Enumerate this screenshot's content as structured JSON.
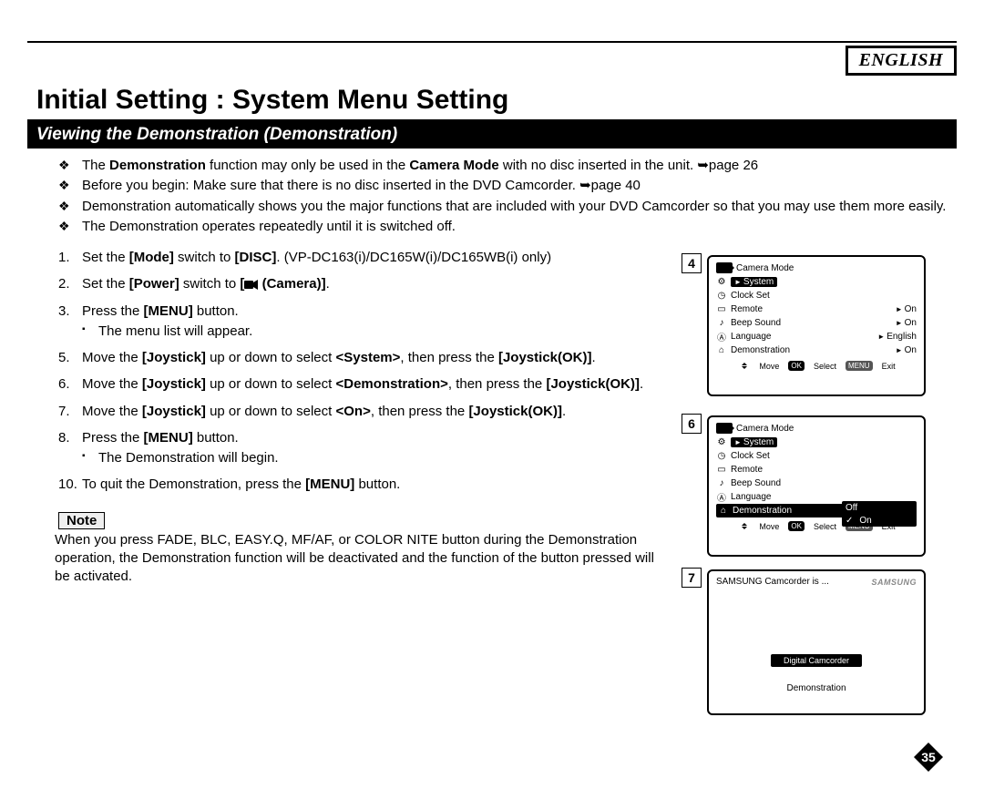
{
  "language_badge": "ENGLISH",
  "title": "Initial Setting : System Menu Setting",
  "subheading": "Viewing the Demonstration (Demonstration)",
  "page_number": "35",
  "bullets": [
    {
      "pre": "The ",
      "b1": "Demonstration",
      "mid": " function may only be used in the ",
      "b2": "Camera Mode",
      "post": " with no disc inserted in the unit. ➥page 26"
    },
    {
      "text": "Before you begin: Make sure that there is no disc inserted in the DVD Camcorder. ➥page 40"
    },
    {
      "text": "Demonstration automatically shows you the major functions that are included with your DVD Camcorder so that you may use them more easily."
    },
    {
      "text": "The Demonstration operates repeatedly until it is switched off."
    }
  ],
  "steps": [
    {
      "html": "Set the <strong>[Mode]</strong> switch to <strong>[DISC]</strong>. (VP-DC163(i)/DC165W(i)/DC165WB(i) only)"
    },
    {
      "html": "Set the <strong>[Power]</strong> switch to <strong>[<svg class='cam-icon' width='15' height='11'><rect x='0' y='1' width='10' height='9' rx='1' fill='#000'/><polygon points='10,3 15,0 15,11 10,8' fill='#000'/></svg> (Camera)]</strong>."
    },
    {
      "html": "Press the <strong>[MENU]</strong> button.",
      "sub": "The menu list will appear."
    },
    {
      "html": "Move the <strong>[Joystick]</strong> up or down to select <strong>&lt;System&gt;</strong>, then press the <strong>[Joystick(OK)]</strong>."
    },
    {
      "html": "Move the <strong>[Joystick]</strong> up or down to select <strong>&lt;Demonstration&gt;</strong>, then press the <strong>[Joystick(OK)]</strong>."
    },
    {
      "html": "Move the <strong>[Joystick]</strong> up or down to select <strong>&lt;On&gt;</strong>, then press the <strong>[Joystick(OK)]</strong>."
    },
    {
      "html": "Press the <strong>[MENU]</strong> button.",
      "sub": "The Demonstration will begin."
    },
    {
      "html": "To quit the Demonstration, press the <strong>[MENU]</strong> button."
    }
  ],
  "note_label": "Note",
  "note_text": "When you press FADE, BLC, EASY.Q, MF/AF, or COLOR NITE button during the Demonstration operation, the Demonstration function will be deactivated and the function of the button pressed will be activated.",
  "shot": {
    "mode_title": "Camera Mode",
    "system": "System",
    "items": {
      "clock": "Clock Set",
      "remote": "Remote",
      "beep": "Beep Sound",
      "lang": "Language",
      "demo": "Demonstration"
    },
    "vals": {
      "on": "On",
      "off": "Off",
      "english": "English"
    },
    "footer": {
      "move": "Move",
      "select": "Select",
      "exit": "Exit",
      "ok": "OK",
      "menu": "MENU"
    }
  },
  "badges": {
    "s4": "4",
    "s6": "6",
    "s7": "7"
  },
  "demo_screen": {
    "header": "SAMSUNG Camcorder is ...",
    "chip": "Digital Camcorder",
    "footer": "Demonstration",
    "brand": "SAMSUNG"
  }
}
